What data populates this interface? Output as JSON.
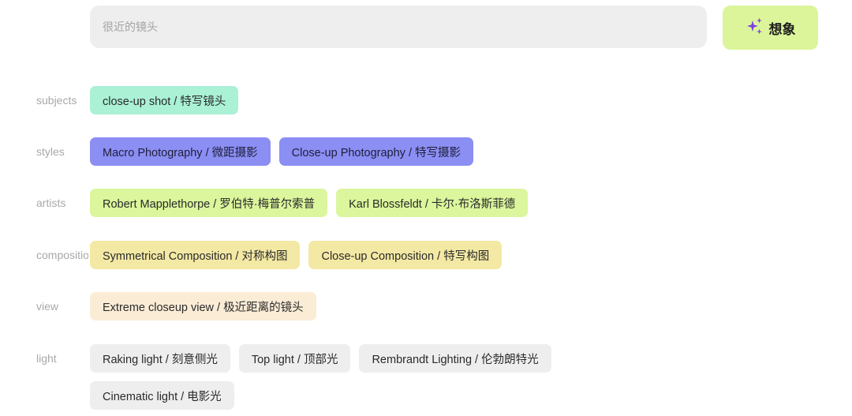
{
  "search": {
    "value": "很近的镜头"
  },
  "imagine_button": {
    "label": "想象",
    "icon": "sparkles-icon",
    "icon_color": "#7b3fe4"
  },
  "categories": [
    {
      "label": "subjects",
      "color": "#aaf1d6",
      "tags": [
        "close-up shot / 特写镜头"
      ]
    },
    {
      "label": "styles",
      "color": "#8b8ef3",
      "tags": [
        "Macro Photography / 微距摄影",
        "Close-up Photography / 特写摄影"
      ]
    },
    {
      "label": "artists",
      "color": "#dbf69c",
      "tags": [
        "Robert Mapplethorpe / 罗伯特·梅普尔索普",
        "Karl Blossfeldt / 卡尔·布洛斯菲德"
      ]
    },
    {
      "label": "composition",
      "color": "#f4e9a4",
      "tags": [
        "Symmetrical Composition / 对称构图",
        "Close-up Composition / 特写构图"
      ]
    },
    {
      "label": "view",
      "color": "#fbecd6",
      "tags": [
        "Extreme closeup view / 极近距离的镜头"
      ]
    },
    {
      "label": "light",
      "color": "#eeeeee",
      "tags": [
        "Raking light / 刻意侧光",
        "Top light / 顶部光",
        "Rembrandt Lighting / 伦勃朗特光",
        "Cinematic light / 电影光"
      ]
    }
  ]
}
